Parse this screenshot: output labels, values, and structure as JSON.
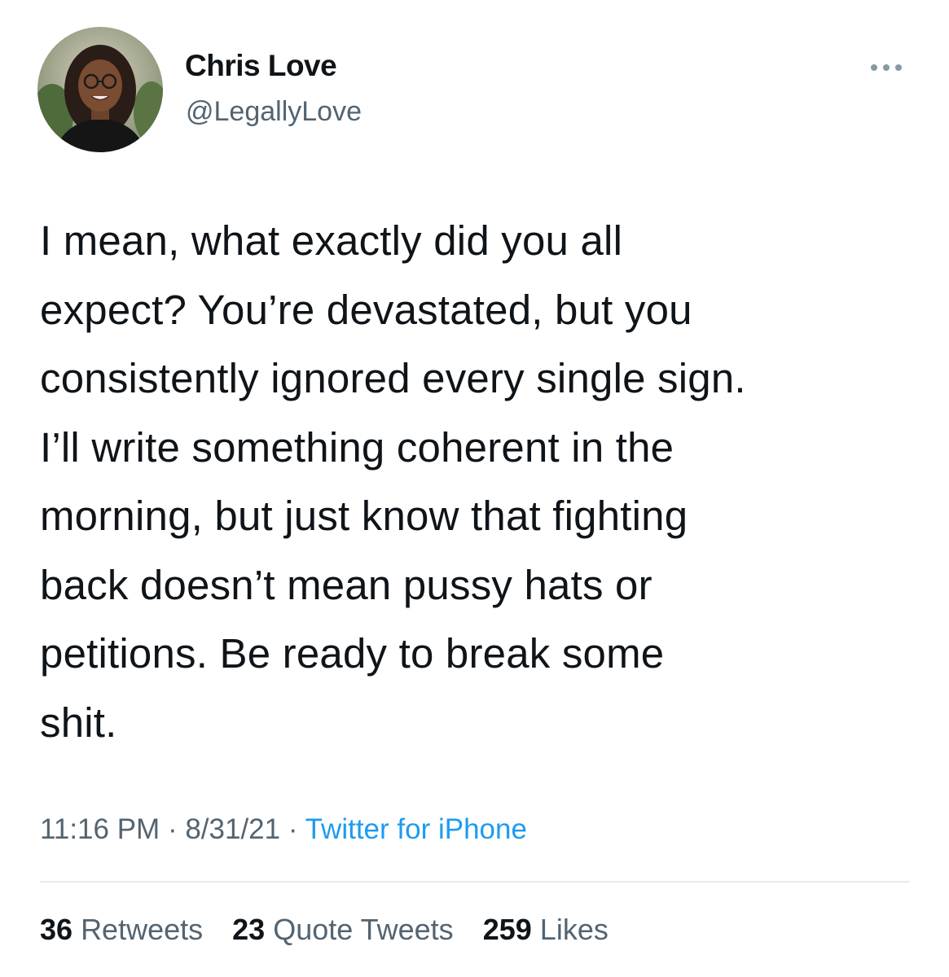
{
  "author": {
    "display_name": "Chris Love",
    "handle": "@LegallyLove",
    "avatar_icon": "profile-photo"
  },
  "tweet": {
    "text": "I mean, what exactly did you all\nexpect? You’re devastated, but you\nconsistently ignored every single sign.\nI’ll write something coherent in the\nmorning, but just know that fighting\nback doesn’t mean pussy hats or\npetitions. Be ready to break some\nshit."
  },
  "meta": {
    "time": "11:16 PM",
    "separator": " · ",
    "date": "8/31/21",
    "source": "Twitter for iPhone"
  },
  "stats": {
    "retweets_count": "36",
    "retweets_label": "Retweets",
    "quotes_count": "23",
    "quotes_label": "Quote Tweets",
    "likes_count": "259",
    "likes_label": "Likes"
  },
  "colors": {
    "text_primary": "#0f1419",
    "text_secondary": "#536471",
    "link": "#1d9bf0",
    "divider": "#e6ecf0"
  },
  "icons": {
    "more": "more-horizontal-icon"
  }
}
